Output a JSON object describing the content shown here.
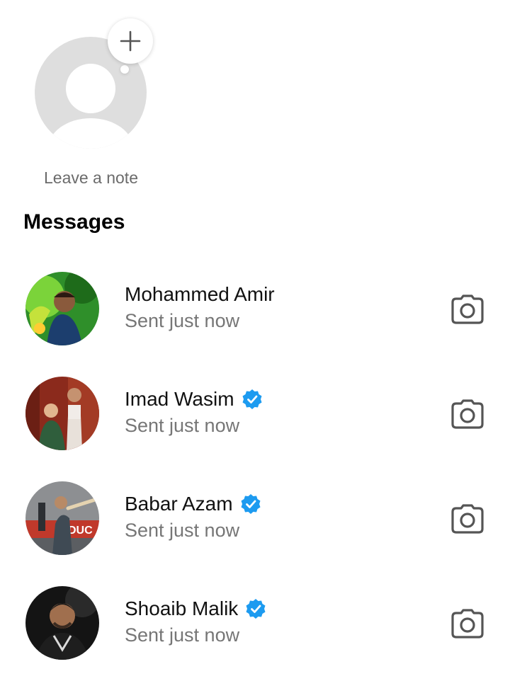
{
  "note": {
    "add_icon": "plus-icon",
    "label": "Leave a note"
  },
  "section": {
    "title": "Messages"
  },
  "colors": {
    "verified_badge": "#1d9bf0",
    "secondary_text": "#767676",
    "icon_stroke": "#555555",
    "placeholder_avatar": "#dedede"
  },
  "messages": [
    {
      "name": "Mohammed Amir",
      "status": "Sent just now",
      "verified": false,
      "action_icon": "camera-icon"
    },
    {
      "name": "Imad Wasim",
      "status": "Sent just now",
      "verified": true,
      "action_icon": "camera-icon"
    },
    {
      "name": "Babar Azam",
      "status": "Sent just now",
      "verified": true,
      "action_icon": "camera-icon"
    },
    {
      "name": "Shoaib Malik",
      "status": "Sent just now",
      "verified": true,
      "action_icon": "camera-icon"
    }
  ]
}
